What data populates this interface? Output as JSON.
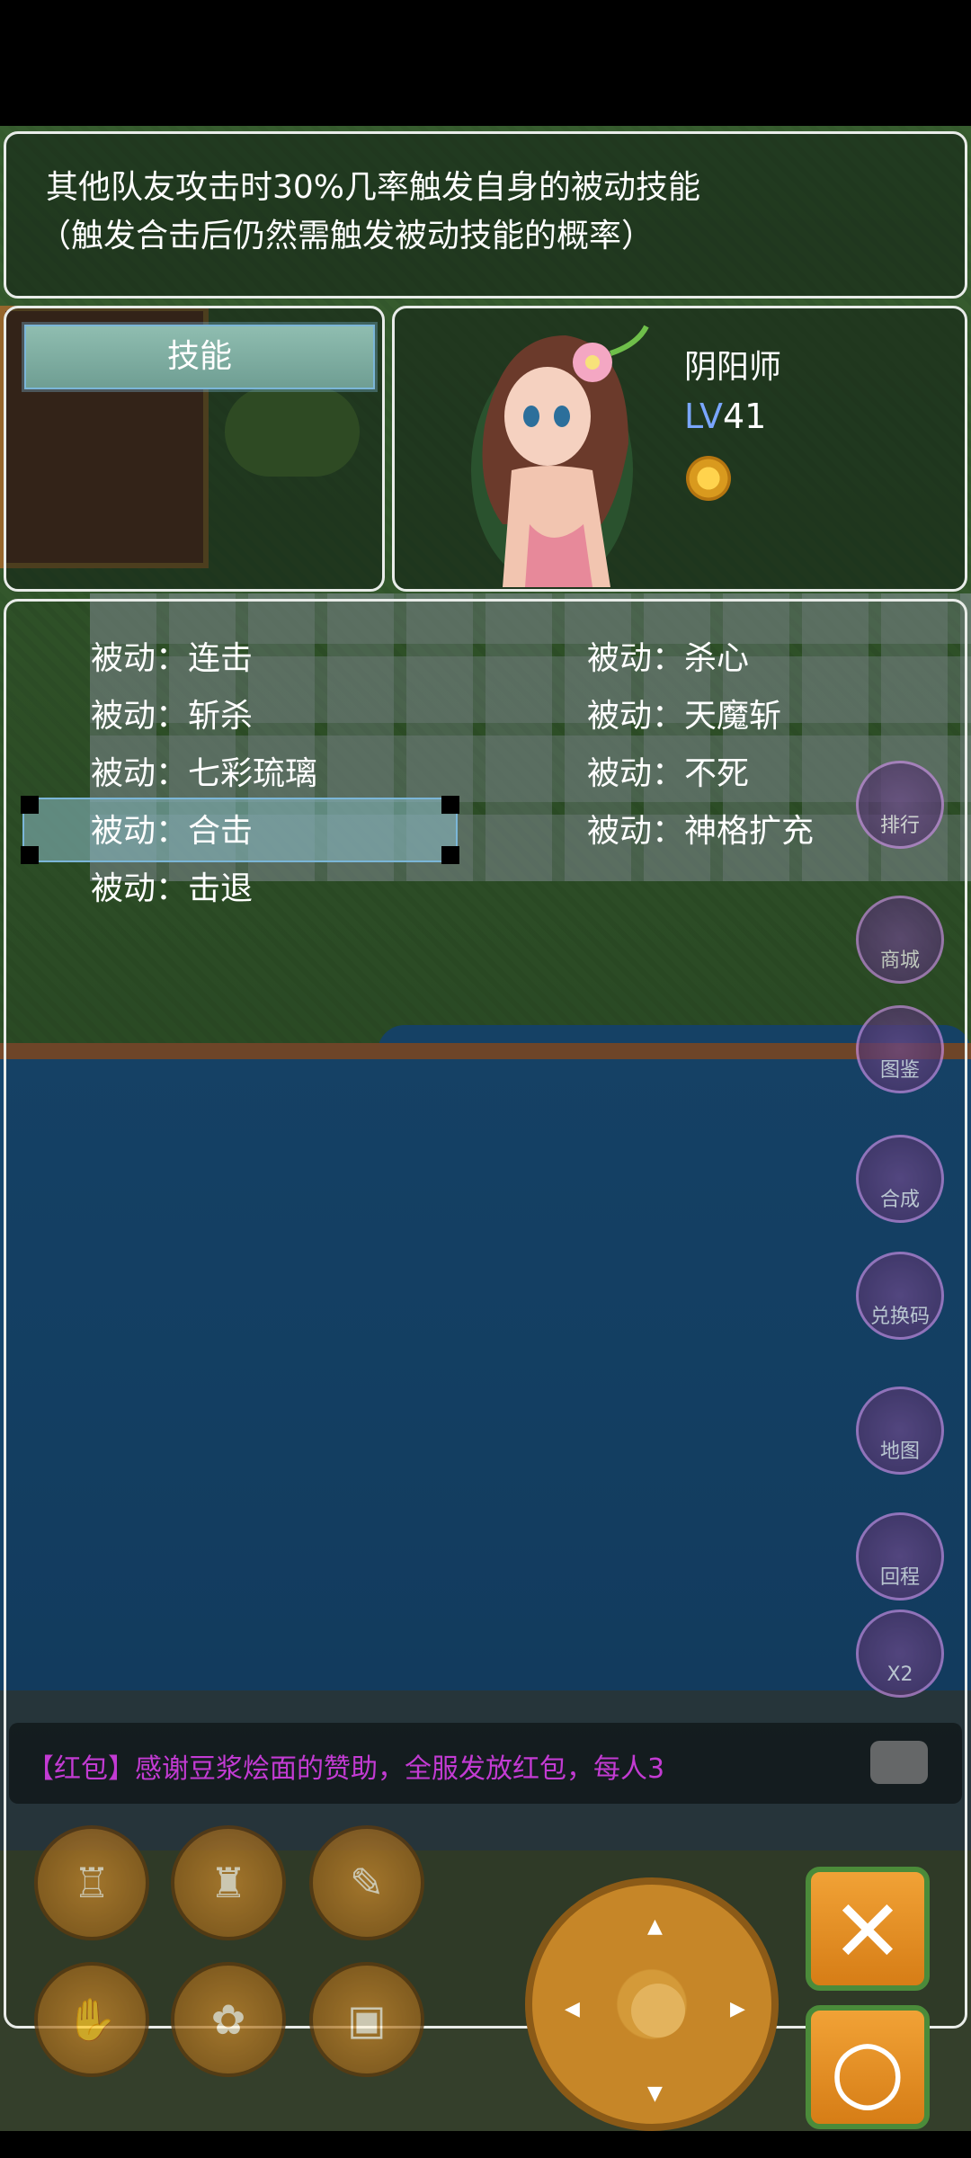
{
  "description": {
    "line1": "其他队友攻击时30%几率触发自身的被动技能",
    "line2": "（触发合击后仍然需触发被动技能的概率）"
  },
  "skill_tab": {
    "label": "技能"
  },
  "character": {
    "class_name": "阴阳师",
    "level_label": "LV",
    "level_value": "41"
  },
  "skills": {
    "left": [
      "被动：连击",
      "被动：斩杀",
      "被动：七彩琉璃",
      "被动：合击",
      "被动：击退"
    ],
    "right": [
      "被动：杀心",
      "被动：天魔斩",
      "被动：不死",
      "被动：神格扩充"
    ],
    "selected": "被动：合击"
  },
  "side_menu": [
    "排行",
    "商城",
    "图鉴",
    "合成",
    "兑换码",
    "地图",
    "回程",
    "X2"
  ],
  "chat": {
    "message": "【红包】感谢豆浆烩面的赞助，全服发放红包，每人3"
  },
  "actions": {
    "close_label": "✕",
    "confirm_label": "○"
  },
  "icons": {
    "bottom_left": [
      "armor-icon",
      "helmet-icon",
      "scroll-icon",
      "hand-icon",
      "paw-icon",
      "gift-icon"
    ],
    "dpad": "dpad-icon"
  },
  "colors": {
    "accent": "#7bb6d8",
    "level_label": "#7aa6ff",
    "chat_text": "#c33bd3",
    "action_border": "#4b8b3a"
  }
}
